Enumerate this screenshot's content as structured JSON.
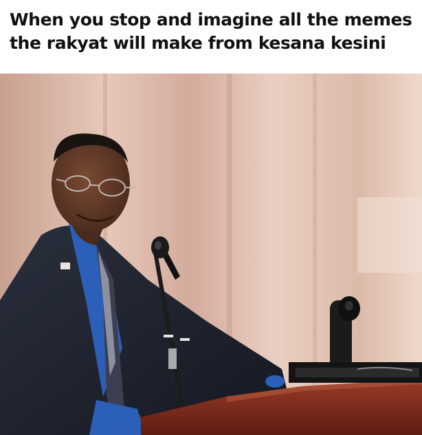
{
  "caption": {
    "line1": "When you stop and imagine all the memes",
    "line2": "the rakyat will make from kesana kesini"
  },
  "photo": {
    "subject": "smiling man in suit at podium with microphones",
    "icons": [
      "microphone-icon",
      "microphone-icon"
    ]
  },
  "colors": {
    "background": "#ffffff",
    "caption_text": "#111111",
    "wall": "#d9b3a4",
    "suit": "#1f2330",
    "shirt": "#2b5fb8",
    "podium": "#7a2a1c"
  }
}
